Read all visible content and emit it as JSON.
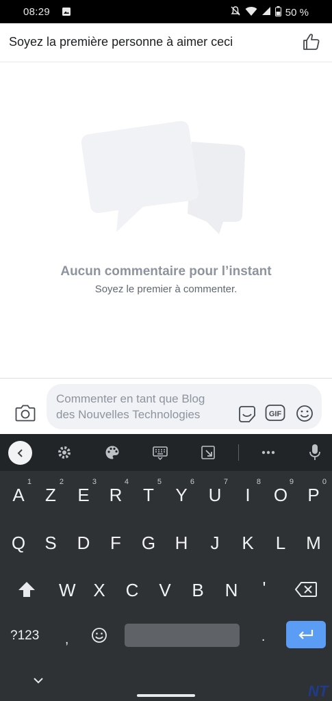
{
  "status_bar": {
    "time": "08:29",
    "battery": "50 %"
  },
  "post_likes": {
    "text": "Soyez la première personne à aimer ceci"
  },
  "empty_state": {
    "title": "Aucun commentaire pour l’instant",
    "subtitle": "Soyez le premier à commenter."
  },
  "composer": {
    "placeholder_line1": "Commenter en tant que Blog",
    "placeholder_line2": "des Nouvelles Technologies",
    "gif_label": "GIF"
  },
  "keyboard": {
    "row1": [
      {
        "key": "A",
        "hint": "1"
      },
      {
        "key": "Z",
        "hint": "2"
      },
      {
        "key": "E",
        "hint": "3"
      },
      {
        "key": "R",
        "hint": "4"
      },
      {
        "key": "T",
        "hint": "5"
      },
      {
        "key": "Y",
        "hint": "6"
      },
      {
        "key": "U",
        "hint": "7"
      },
      {
        "key": "I",
        "hint": "8"
      },
      {
        "key": "O",
        "hint": "9"
      },
      {
        "key": "P",
        "hint": "0"
      }
    ],
    "row2": [
      "Q",
      "S",
      "D",
      "F",
      "G",
      "H",
      "J",
      "K",
      "L",
      "M"
    ],
    "row3": [
      "W",
      "X",
      "C",
      "V",
      "B",
      "N",
      "'"
    ],
    "symbols_label": "?123",
    "comma": ",",
    "period": "."
  },
  "watermark": "NT",
  "colors": {
    "accent_blue": "#5b9cf5",
    "keyboard_bg": "#2f3235",
    "toolbar_bg": "#222528"
  }
}
